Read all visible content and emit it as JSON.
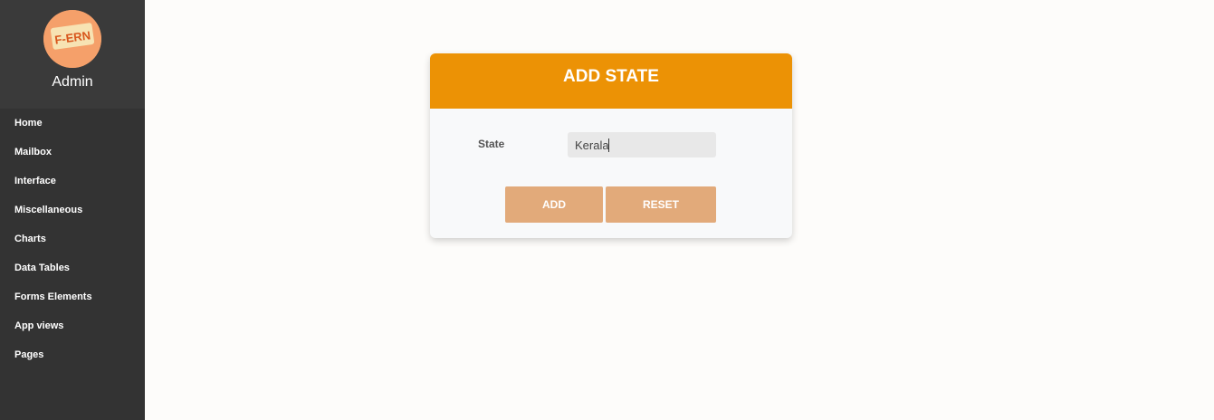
{
  "sidebar": {
    "admin_name": "Admin",
    "logo_text": "F-ERN",
    "items": [
      {
        "label": "Home"
      },
      {
        "label": "Mailbox"
      },
      {
        "label": "Interface"
      },
      {
        "label": "Miscellaneous"
      },
      {
        "label": "Charts"
      },
      {
        "label": "Data Tables"
      },
      {
        "label": "Forms Elements"
      },
      {
        "label": "App views"
      },
      {
        "label": "Pages"
      }
    ]
  },
  "form": {
    "title": "ADD STATE",
    "state_label": "State",
    "state_value": "Kerala",
    "add_label": "ADD",
    "reset_label": "RESET"
  },
  "colors": {
    "sidebar_bg": "#333333",
    "header_accent": "#ec9205",
    "button_bg": "#e2aa7a"
  }
}
